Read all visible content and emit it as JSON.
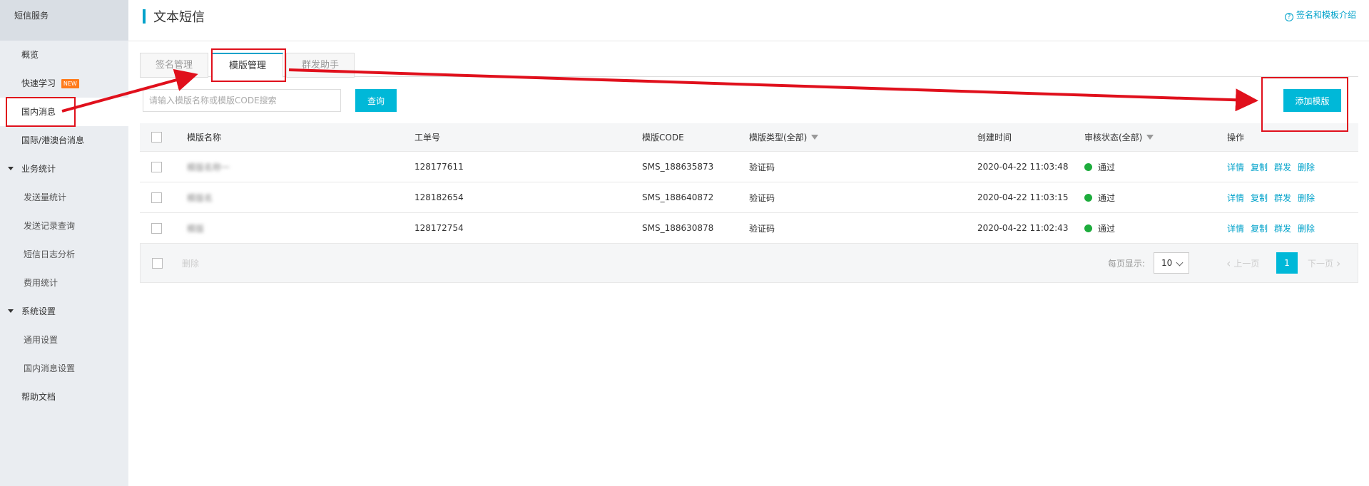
{
  "sidebar": {
    "title": "短信服务",
    "items": [
      {
        "label": "概览"
      },
      {
        "label": "快速学习",
        "badge": "NEW"
      },
      {
        "label": "国内消息"
      },
      {
        "label": "国际/港澳台消息"
      },
      {
        "label": "业务统计"
      },
      {
        "label": "发送量统计"
      },
      {
        "label": "发送记录查询"
      },
      {
        "label": "短信日志分析"
      },
      {
        "label": "费用统计"
      },
      {
        "label": "系统设置"
      },
      {
        "label": "通用设置"
      },
      {
        "label": "国内消息设置"
      },
      {
        "label": "帮助文档"
      }
    ]
  },
  "header": {
    "title": "文本短信",
    "help_label": "签名和模板介绍"
  },
  "tabs": [
    {
      "label": "签名管理"
    },
    {
      "label": "模版管理"
    },
    {
      "label": "群发助手"
    }
  ],
  "search": {
    "placeholder": "请输入模版名称或模版CODE搜索",
    "query_label": "查询",
    "add_label": "添加模版"
  },
  "table": {
    "columns": {
      "name": "模版名称",
      "ticket": "工单号",
      "code": "模版CODE",
      "type": "模版类型(全部)",
      "created": "创建时间",
      "status": "审核状态(全部)",
      "ops": "操作"
    },
    "rows": [
      {
        "name": "模版名称一",
        "ticket": "128177611",
        "code": "SMS_188635873",
        "type": "验证码",
        "created": "2020-04-22 11:03:48",
        "status": "通过"
      },
      {
        "name": "模版名",
        "ticket": "128182654",
        "code": "SMS_188640872",
        "type": "验证码",
        "created": "2020-04-22 11:03:15",
        "status": "通过"
      },
      {
        "name": "模版",
        "ticket": "128172754",
        "code": "SMS_188630878",
        "type": "验证码",
        "created": "2020-04-22 11:02:43",
        "status": "通过"
      }
    ],
    "ops": {
      "detail": "详情",
      "copy": "复制",
      "bulk": "群发",
      "delete": "删除"
    }
  },
  "footer": {
    "delete_label": "删除",
    "per_page_label": "每页显示:",
    "per_page_value": "10",
    "prev_label": "上一页",
    "current_page": "1",
    "next_label": "下一页"
  },
  "colors": {
    "accent": "#00b8d8",
    "annotation": "#e0101c",
    "status_ok": "#1dac3c"
  }
}
